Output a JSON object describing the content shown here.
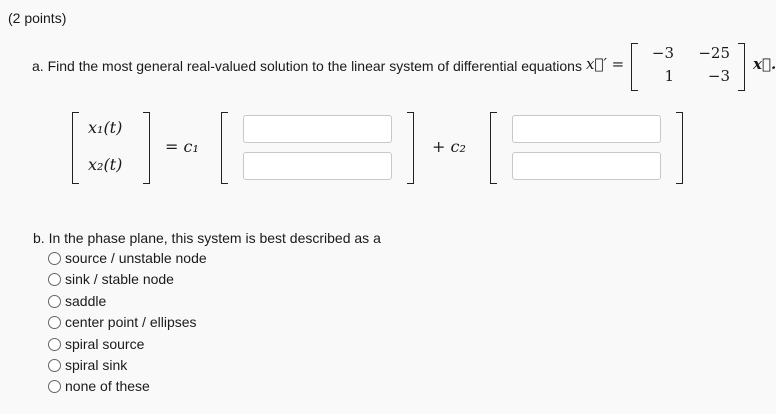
{
  "points": "(2 points)",
  "part_a": {
    "prompt": "a. Find the most general real-valued solution to the linear system of differential equations",
    "lhs": "x⃗′ =",
    "matrix": [
      [
        "−3",
        "−25"
      ],
      [
        "1",
        "−3"
      ]
    ],
    "rhs": "x⃗.",
    "x1": "x₁(t)",
    "x2": "x₂(t)",
    "eq_c1": "= c₁",
    "plus_c2": "+ c₂",
    "vector1": {
      "top": "",
      "bottom": ""
    },
    "vector2": {
      "top": "",
      "bottom": ""
    }
  },
  "part_b": {
    "prompt": "b. In the phase plane, this system is best described as a",
    "options": [
      "source / unstable node",
      "sink / stable node",
      "saddle",
      "center point / ellipses",
      "spiral source",
      "spiral sink",
      "none of these"
    ]
  }
}
